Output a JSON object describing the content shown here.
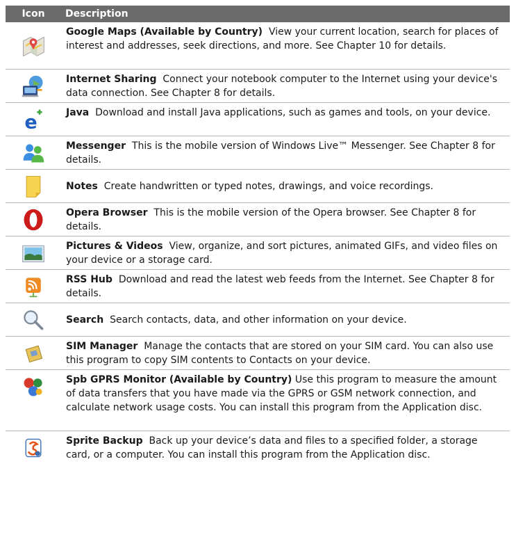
{
  "header": {
    "icon": "Icon",
    "description": "Description"
  },
  "rows": [
    {
      "icon": "google-maps-icon",
      "name": "Google Maps (Available by Country)",
      "text": "View your current location, search for places of interest and addresses, seek directions, and more. See Chapter 10 for details."
    },
    {
      "icon": "internet-sharing-icon",
      "name": "Internet Sharing",
      "text": "Connect your notebook computer to the Internet using your device's data connection. See Chapter 8 for details."
    },
    {
      "icon": "java-icon",
      "name": "Java",
      "text": "Download and install Java applications, such as games and tools, on your device."
    },
    {
      "icon": "messenger-icon",
      "name": "Messenger",
      "text": "This is the mobile version of Windows Live™ Messenger. See Chapter 8 for details."
    },
    {
      "icon": "notes-icon",
      "name": "Notes",
      "text": "Create handwritten or typed notes, drawings, and voice recordings."
    },
    {
      "icon": "opera-icon",
      "name": "Opera Browser",
      "text": "This is the mobile version of the Opera browser. See Chapter 8 for details."
    },
    {
      "icon": "pictures-icon",
      "name": "Pictures & Videos",
      "text": "View, organize, and sort pictures, animated GIFs, and video files on your device or a storage card."
    },
    {
      "icon": "rss-icon",
      "name": "RSS Hub",
      "text": "Download and read the latest web feeds from the Internet. See Chapter 8 for details."
    },
    {
      "icon": "search-icon",
      "name": "Search",
      "text": "Search contacts, data, and other information on your device."
    },
    {
      "icon": "sim-manager-icon",
      "name": "SIM Manager",
      "text": "Manage the contacts that are stored on your SIM card. You can also use this program to copy SIM contents to Contacts on your device."
    },
    {
      "icon": "gprs-monitor-icon",
      "name": "Spb GPRS Monitor (Available by Country)",
      "text": "Use this program to measure the amount of data transfers that you have made via the GPRS or GSM network connection, and calculate network usage costs. You can install this program from the Application disc."
    },
    {
      "icon": "sprite-backup-icon",
      "name": "Sprite Backup",
      "text": "Back up your device’s data and files to a specified folder, a storage card, or a computer. You can install this program from the Application disc."
    }
  ]
}
